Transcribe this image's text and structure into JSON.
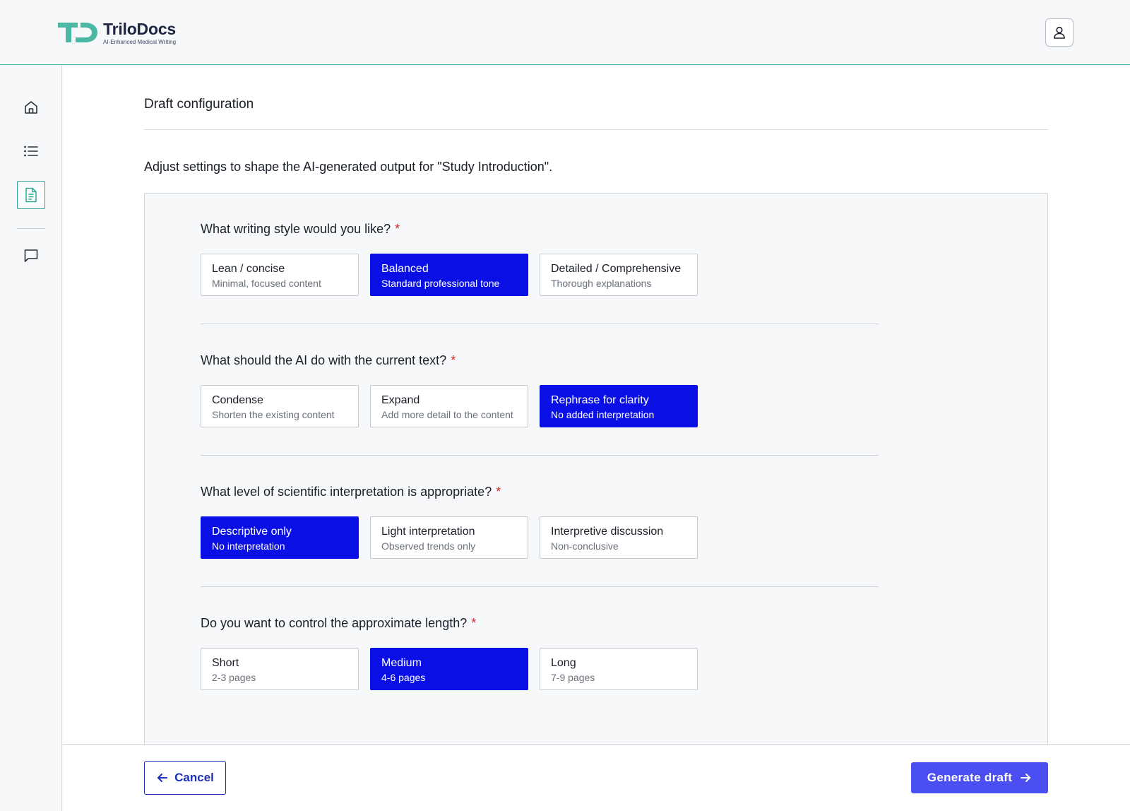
{
  "brand": {
    "name": "TriloDocs",
    "tagline": "AI-Enhanced Medical Writing",
    "accent": "#2fa596",
    "primary": "#0a0fe6"
  },
  "header": {
    "user_icon": "user-icon"
  },
  "sidebar": {
    "items": [
      {
        "icon": "home-icon",
        "active": false
      },
      {
        "icon": "list-icon",
        "active": false
      },
      {
        "icon": "document-icon",
        "active": true
      },
      {
        "icon": "chat-icon",
        "active": false
      }
    ]
  },
  "page": {
    "title": "Draft configuration",
    "intro": "Adjust settings to shape the AI-generated output for \"Study Introduction\"."
  },
  "questions": [
    {
      "label": "What writing style would you like?",
      "required": "*",
      "options": [
        {
          "title": "Lean / concise",
          "desc": "Minimal, focused content",
          "selected": false
        },
        {
          "title": "Balanced",
          "desc": "Standard professional tone",
          "selected": true
        },
        {
          "title": "Detailed / Comprehensive",
          "desc": "Thorough explanations",
          "selected": false
        }
      ]
    },
    {
      "label": "What should the AI do with the current text?",
      "required": "*",
      "options": [
        {
          "title": "Condense",
          "desc": "Shorten the existing content",
          "selected": false
        },
        {
          "title": "Expand",
          "desc": "Add more detail to the content",
          "selected": false
        },
        {
          "title": "Rephrase for clarity",
          "desc": "No added interpretation",
          "selected": true
        }
      ]
    },
    {
      "label": "What level of scientific interpretation is appropriate?",
      "required": "*",
      "options": [
        {
          "title": "Descriptive only",
          "desc": "No interpretation",
          "selected": true
        },
        {
          "title": "Light interpretation",
          "desc": "Observed trends only",
          "selected": false
        },
        {
          "title": "Interpretive discussion",
          "desc": "Non-conclusive",
          "selected": false
        }
      ]
    },
    {
      "label": "Do you want to control the approximate length?",
      "required": "*",
      "options": [
        {
          "title": "Short",
          "desc": "2-3 pages",
          "selected": false
        },
        {
          "title": "Medium",
          "desc": "4-6 pages",
          "selected": true
        },
        {
          "title": "Long",
          "desc": "7-9 pages",
          "selected": false
        }
      ]
    }
  ],
  "footer": {
    "cancel_label": "Cancel",
    "generate_label": "Generate draft"
  }
}
